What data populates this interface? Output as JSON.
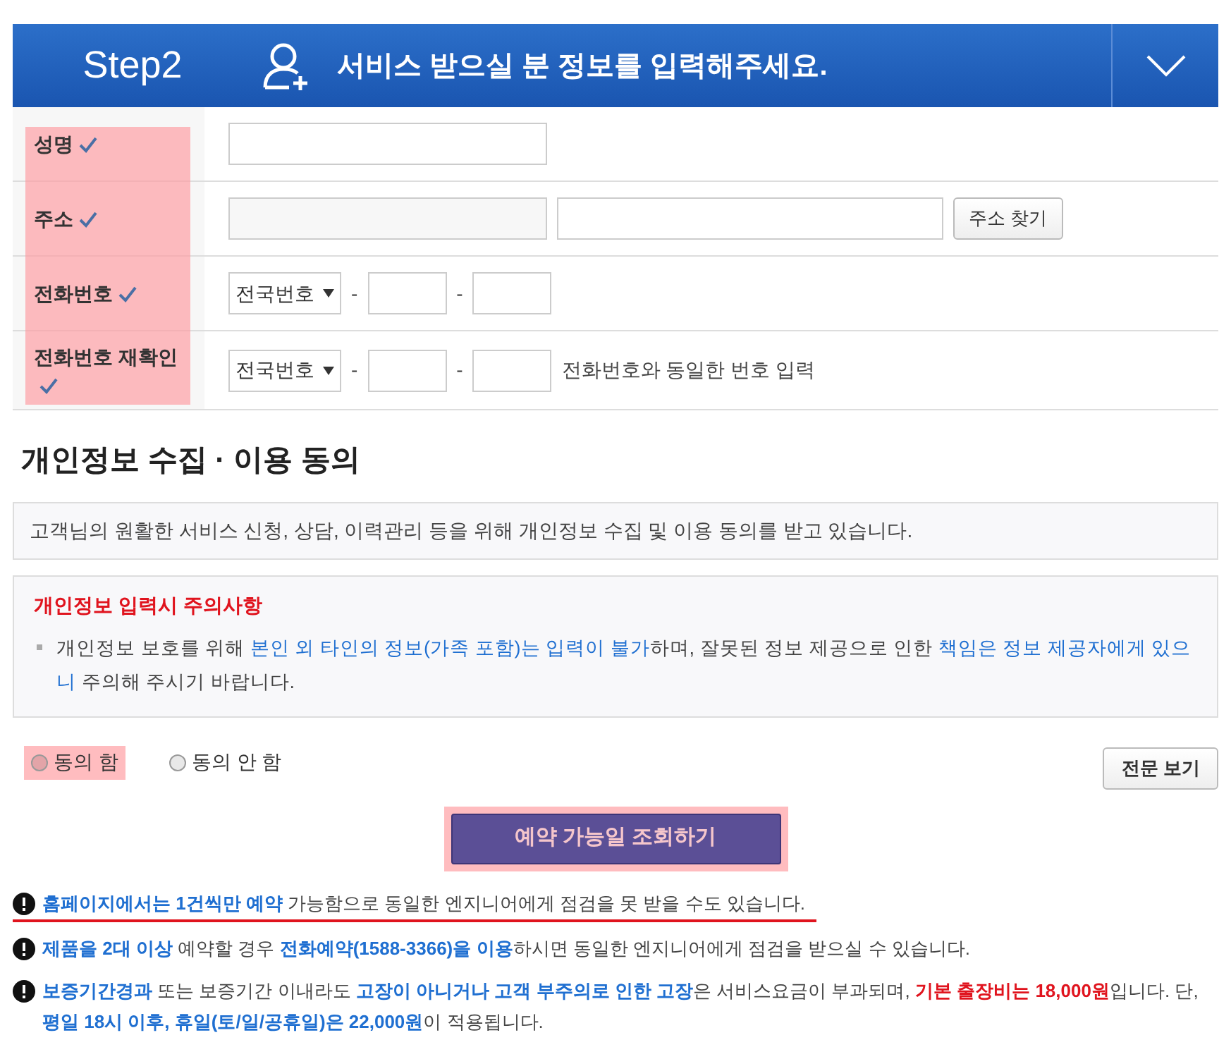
{
  "header": {
    "step": "Step2",
    "title": "서비스 받으실 분 정보를 입력해주세요.",
    "expanded": false
  },
  "form": {
    "highlighted": true,
    "rows": [
      {
        "kind": "name",
        "label": "성명",
        "required": true
      },
      {
        "kind": "address",
        "label": "주소",
        "required": true,
        "button": "주소 찾기"
      },
      {
        "kind": "phone",
        "label": "전화번호",
        "required": true,
        "select": "전국번호",
        "dash": "-"
      },
      {
        "kind": "phone",
        "label": "전화번호 재확인",
        "required": true,
        "select": "전국번호",
        "dash": "-",
        "hint": "전화번호와 동일한 번호 입력"
      }
    ]
  },
  "privacy": {
    "title": "개인정보 수집 · 이용 동의",
    "intro": "고객님의 원활한 서비스 신청, 상담, 이력관리 등을 위해 개인정보 수집 및 이용 동의를 받고 있습니다.",
    "notice_title": "개인정보 입력시 주의사항",
    "notice": [
      {
        "text": "개인정보 보호를 위해 ",
        "color": "#444444",
        "bold": false
      },
      {
        "text": "본인 외 타인의 정보(가족 포함)는 입력이 불가",
        "color": "#1f6fd1",
        "bold": false
      },
      {
        "text": "하며, 잘못된 정보 제공으로 인한 ",
        "color": "#444444",
        "bold": false
      },
      {
        "text": "책임은 정보 제공자에게 있으니",
        "color": "#1f6fd1",
        "bold": false
      },
      {
        "text": " 주의해 주시기 바랍니다.",
        "color": "#444444",
        "bold": false
      }
    ],
    "options": [
      {
        "label": "동의 함",
        "selected": false,
        "highlighted": true
      },
      {
        "label": "동의 안 함",
        "selected": false,
        "highlighted": false
      }
    ],
    "full_text_button": "전문 보기"
  },
  "submit": {
    "label": "예약 가능일 조회하기",
    "highlighted": true
  },
  "notes": [
    {
      "underlined": true,
      "parts": [
        {
          "text": "홈페이지에서는 1건씩만 예약",
          "color": "#1f6fd1",
          "bold": true
        },
        {
          "text": " 가능함으로 동일한 엔지니어에게 점검을 못 받을 수도 있습니다.",
          "color": "#444444",
          "bold": false
        }
      ]
    },
    {
      "underlined": false,
      "parts": [
        {
          "text": "제품을 2대 이상",
          "color": "#1f6fd1",
          "bold": true
        },
        {
          "text": " 예약할 경우 ",
          "color": "#444444",
          "bold": false
        },
        {
          "text": "전화예약(1588-3366)을 이용",
          "color": "#1f6fd1",
          "bold": true
        },
        {
          "text": "하시면 동일한 엔지니어에게 점검을 받으실 수 있습니다.",
          "color": "#444444",
          "bold": false
        }
      ]
    },
    {
      "underlined": false,
      "parts": [
        {
          "text": "보증기간경과",
          "color": "#1f6fd1",
          "bold": true
        },
        {
          "text": " 또는 보증기간 이내라도 ",
          "color": "#444444",
          "bold": false
        },
        {
          "text": "고장이 아니거나 고객 부주의로 인한 고장",
          "color": "#1f6fd1",
          "bold": true
        },
        {
          "text": "은 서비스요금이 부과되며, ",
          "color": "#444444",
          "bold": false
        },
        {
          "text": "기본 출장비는 18,000원",
          "color": "#e0141e",
          "bold": true
        },
        {
          "text": "입니다. 단, ",
          "color": "#444444",
          "bold": false
        },
        {
          "text": "평일 18시 이후, 휴일(토/일/공휴일)은 22,000원",
          "color": "#1f6fd1",
          "bold": true
        },
        {
          "text": "이 적용됩니다.",
          "color": "#444444",
          "bold": false
        }
      ]
    }
  ]
}
